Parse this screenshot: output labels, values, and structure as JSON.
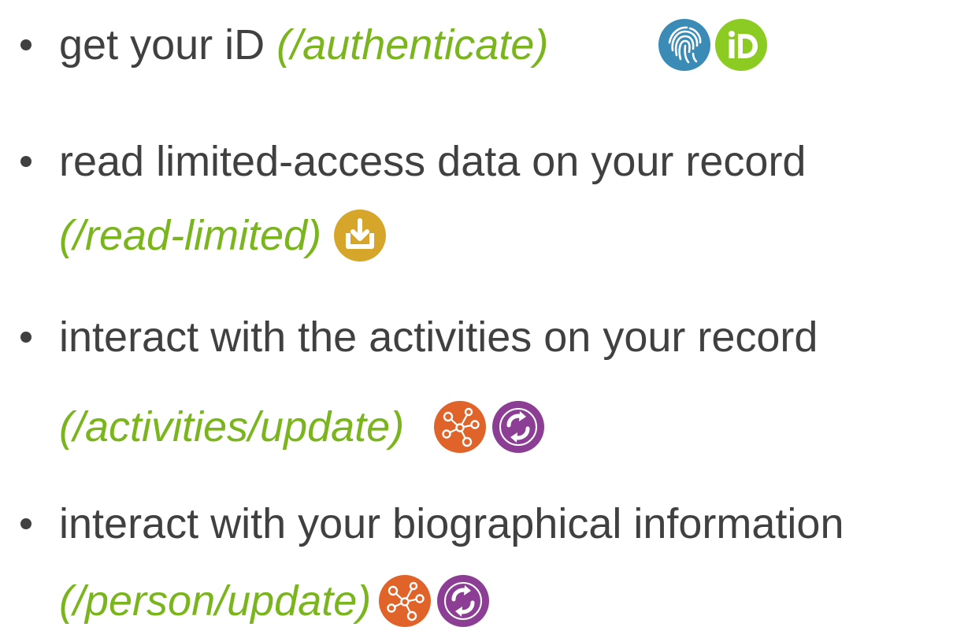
{
  "bullets": [
    {
      "text": "get your iD",
      "scope": "(/authenticate)",
      "icons": [
        "fingerprint-icon",
        "orcid-id-icon"
      ]
    },
    {
      "text": "read limited-access data on your record",
      "scope": "(/read-limited)",
      "icons": [
        "download-icon"
      ]
    },
    {
      "text": "interact with the activities on your record",
      "scope": "(/activities/update)",
      "icons": [
        "network-icon",
        "refresh-icon"
      ]
    },
    {
      "text": "interact with your biographical information",
      "scope": "(/person/update)",
      "icons": [
        "network-icon",
        "refresh-icon"
      ]
    }
  ],
  "colors": {
    "text": "#404040",
    "scope": "#7ab51d",
    "fingerprint": "#3b8bb7",
    "orcid": "#8ccc22",
    "download": "#d6a62a",
    "network": "#e0632a",
    "refresh": "#8b3e94"
  }
}
